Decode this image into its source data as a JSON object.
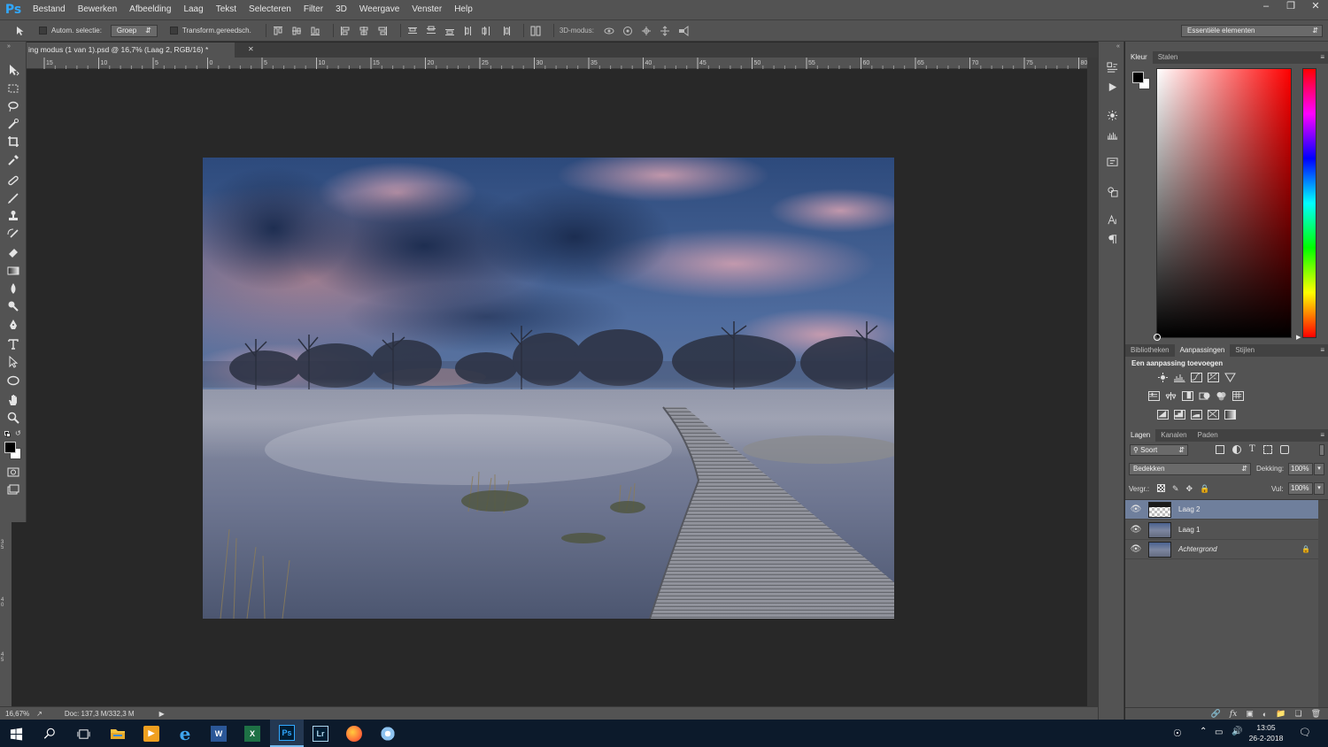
{
  "menubar": {
    "app_logo": "Ps",
    "items": [
      "Bestand",
      "Bewerken",
      "Afbeelding",
      "Laag",
      "Tekst",
      "Selecteren",
      "Filter",
      "3D",
      "Weergave",
      "Venster",
      "Help"
    ],
    "window_controls": [
      "minimize-icon",
      "restore-icon",
      "close-icon"
    ]
  },
  "options": {
    "auto_select_label": "Autom. selectie:",
    "auto_select_value": "Groep",
    "transform_label": "Transform.gereedsch.",
    "mode_3d_label": "3D-modus:",
    "workspace": "Essentiële elementen"
  },
  "document": {
    "tab_title": "ing modus (1 van 1).psd @ 16,7% (Laag 2, RGB/16) *",
    "ruler_labels": [
      "15",
      "10",
      "5",
      "0",
      "5",
      "10",
      "15",
      "20",
      "25",
      "30",
      "35",
      "40",
      "45",
      "50",
      "55",
      "60",
      "65",
      "70",
      "75",
      "80"
    ],
    "left_ruler_labels": [
      "3 5",
      "4 0",
      "4 5"
    ]
  },
  "status": {
    "zoom": "16,67%",
    "doc_info": "Doc: 137,3 M/332,3 M"
  },
  "color_panel": {
    "tabs": [
      "Kleur",
      "Stalen"
    ],
    "foreground": "#000000",
    "background": "#ffffff",
    "hue_base": "#ff0000"
  },
  "adjustments_panel": {
    "tabs": [
      "Bibliotheken",
      "Aanpassingen",
      "Stijlen"
    ],
    "title": "Een aanpassing toevoegen"
  },
  "layers_panel": {
    "tabs": [
      "Lagen",
      "Kanalen",
      "Paden"
    ],
    "filter_label": "Soort",
    "blend_mode": "Bedekken",
    "opacity_label": "Dekking:",
    "opacity_value": "100%",
    "lock_label": "Vergr.:",
    "fill_label": "Vul:",
    "fill_value": "100%",
    "layers": [
      {
        "name": "Laag 2",
        "selected": true,
        "locked": false
      },
      {
        "name": "Laag 1",
        "selected": false,
        "locked": false
      },
      {
        "name": "Achtergrond",
        "selected": false,
        "locked": true
      }
    ]
  },
  "taskbar": {
    "apps": [
      "Verkenner",
      "Media",
      "Internet Explorer",
      "W",
      "X",
      "Ps",
      "Lr",
      "Firefox",
      "Paint"
    ],
    "time": "13:05",
    "date": "26-2-2018"
  }
}
